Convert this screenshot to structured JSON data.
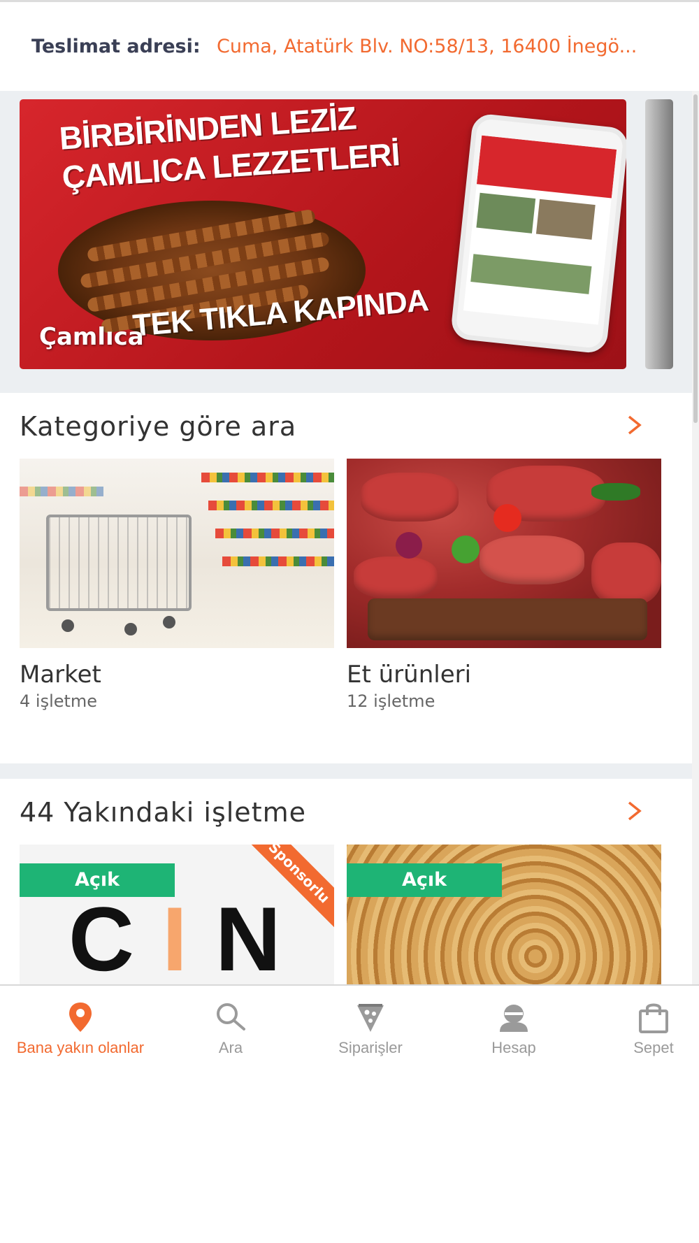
{
  "header": {
    "address_label": "Teslimat adresi:",
    "address_value": "Cuma, Atatürk Blv. NO:58/13, 16400 İnegö..."
  },
  "banner": {
    "headline_line1": "BİRBİRİNDEN LEZİZ",
    "headline_line2": "ÇAMLICA LEZZETLERİ",
    "tagline": "TEK TIKLA KAPINDA",
    "name": "Çamlıca"
  },
  "categories": {
    "title": "Kategoriye göre ara",
    "items": [
      {
        "name": "Market",
        "count": "4 işletme"
      },
      {
        "name": "Et ürünleri",
        "count": "12 işletme"
      }
    ]
  },
  "nearby": {
    "title": "44 Yakındaki işletme",
    "items": [
      {
        "status": "Açık",
        "sponsored_label": "Sponsorlu",
        "logo_text": "CIN"
      },
      {
        "status": "Açık"
      }
    ]
  },
  "bottom_nav": {
    "items": [
      {
        "label": "Bana yakın olanlar",
        "icon": "location-pin-icon",
        "active": true
      },
      {
        "label": "Ara",
        "icon": "search-icon",
        "active": false
      },
      {
        "label": "Siparişler",
        "icon": "pizza-slice-icon",
        "active": false
      },
      {
        "label": "Hesap",
        "icon": "user-icon",
        "active": false
      },
      {
        "label": "Sepet",
        "icon": "shopping-bag-icon",
        "active": false
      }
    ]
  },
  "colors": {
    "accent": "#f26a30",
    "open_badge": "#1eb475",
    "address_label": "#3a3f55",
    "section_bg": "#eceff2",
    "inactive_nav": "#9a9a9a"
  }
}
